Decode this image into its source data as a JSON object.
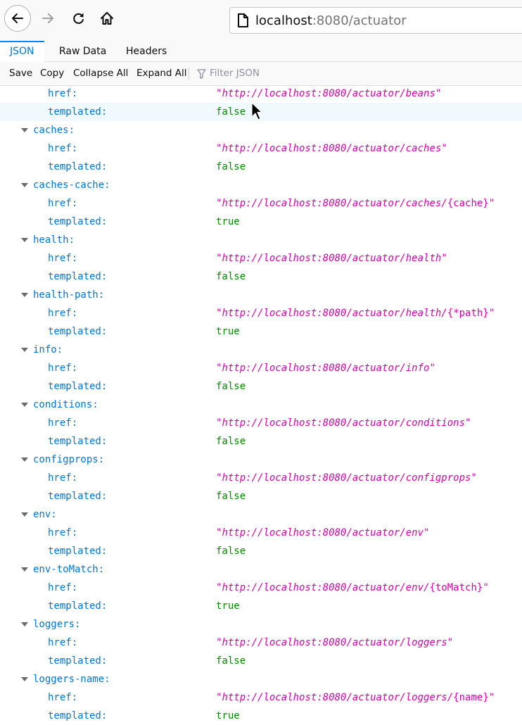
{
  "toolbar": {
    "url_host": "localhost",
    "url_rest": ":8080/actuator"
  },
  "tabs": [
    {
      "label": "JSON",
      "selected": true
    },
    {
      "label": "Raw Data",
      "selected": false
    },
    {
      "label": "Headers",
      "selected": false
    }
  ],
  "actions": {
    "save": "Save",
    "copy": "Copy",
    "collapse_all": "Collapse All",
    "expand_all": "Expand All",
    "filter_placeholder": "Filter JSON"
  },
  "tree": {
    "first": [
      {
        "key": "href:",
        "pre": "\"",
        "italic": "http://localhost:8080/actuator/beans",
        "brace": "",
        "post": "\""
      },
      {
        "key": "templated:",
        "bool": "false"
      }
    ],
    "groups": [
      {
        "name": "caches:",
        "href": {
          "pre": "\"",
          "italic": "http://localhost:8080/actuator/caches",
          "brace": "",
          "post": "\""
        },
        "templated": "false"
      },
      {
        "name": "caches-cache:",
        "href": {
          "pre": "\"",
          "italic": "http://localhost:8080/actuator/caches/",
          "brace": "{cache}",
          "post": "\""
        },
        "templated": "true"
      },
      {
        "name": "health:",
        "href": {
          "pre": "\"",
          "italic": "http://localhost:8080/actuator/health",
          "brace": "",
          "post": "\""
        },
        "templated": "false"
      },
      {
        "name": "health-path:",
        "href": {
          "pre": "\"",
          "italic": "http://localhost:8080/actuator/health/",
          "brace": "{*path}",
          "post": "\""
        },
        "templated": "true"
      },
      {
        "name": "info:",
        "href": {
          "pre": "\"",
          "italic": "http://localhost:8080/actuator/info",
          "brace": "",
          "post": "\""
        },
        "templated": "false"
      },
      {
        "name": "conditions:",
        "href": {
          "pre": "\"",
          "italic": "http://localhost:8080/actuator/conditions",
          "brace": "",
          "post": "\""
        },
        "templated": "false"
      },
      {
        "name": "configprops:",
        "href": {
          "pre": "\"",
          "italic": "http://localhost:8080/actuator/configprops",
          "brace": "",
          "post": "\""
        },
        "templated": "false"
      },
      {
        "name": "env:",
        "href": {
          "pre": "\"",
          "italic": "http://localhost:8080/actuator/env",
          "brace": "",
          "post": "\""
        },
        "templated": "false"
      },
      {
        "name": "env-toMatch:",
        "href": {
          "pre": "\"",
          "italic": "http://localhost:8080/actuator/env/",
          "brace": "{toMatch}",
          "post": "\""
        },
        "templated": "true"
      },
      {
        "name": "loggers:",
        "href": {
          "pre": "\"",
          "italic": "http://localhost:8080/actuator/loggers",
          "brace": "",
          "post": "\""
        },
        "templated": "false"
      },
      {
        "name": "loggers-name:",
        "href": {
          "pre": "\"",
          "italic": "http://localhost:8080/actuator/loggers/",
          "brace": "{name}",
          "post": "\""
        },
        "templated": "true"
      }
    ],
    "child_keys": {
      "href": "href:",
      "templated": "templated:"
    }
  }
}
